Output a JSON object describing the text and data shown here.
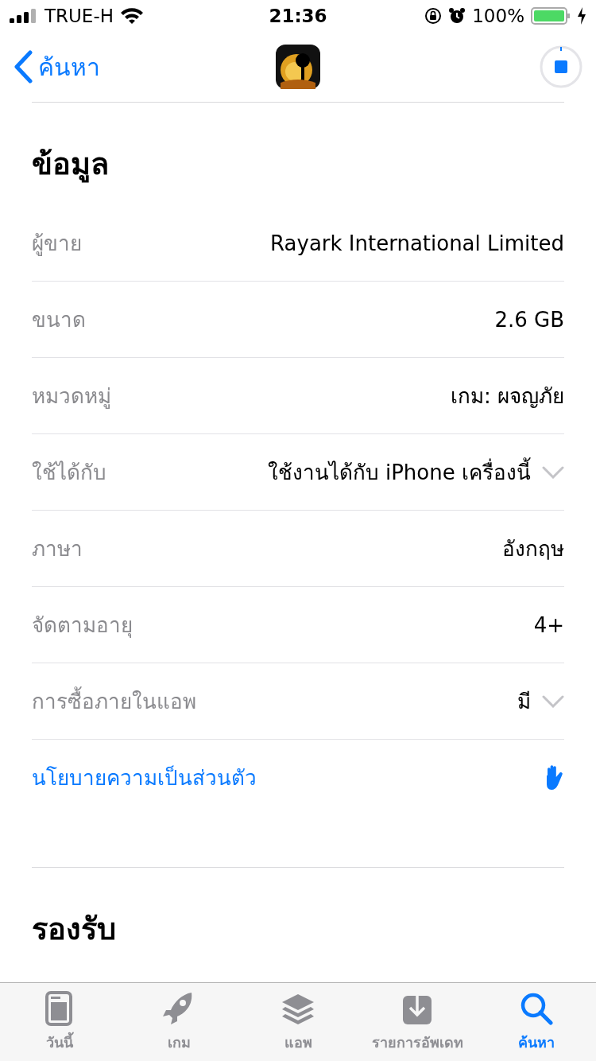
{
  "status_bar": {
    "carrier": "TRUE-H",
    "time": "21:36",
    "battery": "100%"
  },
  "nav": {
    "back": "ค้นหา"
  },
  "info": {
    "title": "ข้อมูล",
    "rows": [
      {
        "kind": "row",
        "label": "ผู้ขาย",
        "value": "Rayark International Limited",
        "expandable": false
      },
      {
        "kind": "row",
        "label": "ขนาด",
        "value": "2.6 GB",
        "expandable": false
      },
      {
        "kind": "row",
        "label": "หมวดหมู่",
        "value": "เกม: ผจญภัย",
        "expandable": false
      },
      {
        "kind": "row",
        "label": "ใช้ได้กับ",
        "value": "ใช้งานได้กับ iPhone เครื่องนี้",
        "expandable": true
      },
      {
        "kind": "row",
        "label": "ภาษา",
        "value": "อังกฤษ",
        "expandable": false
      },
      {
        "kind": "row",
        "label": "จัดตามอายุ",
        "value": "4+",
        "expandable": false
      },
      {
        "kind": "row",
        "label": "การซื้อภายในแอพ",
        "value": "มี",
        "expandable": true
      },
      {
        "kind": "link",
        "label": "นโยบายความเป็นส่วนตัว"
      }
    ]
  },
  "supports": {
    "title": "รองรับ"
  },
  "tabs": [
    {
      "label": "วันนี้",
      "selected": false
    },
    {
      "label": "เกม",
      "selected": false
    },
    {
      "label": "แอพ",
      "selected": false
    },
    {
      "label": "รายการอัพเดท",
      "selected": false
    },
    {
      "label": "ค้นหา",
      "selected": true
    }
  ]
}
